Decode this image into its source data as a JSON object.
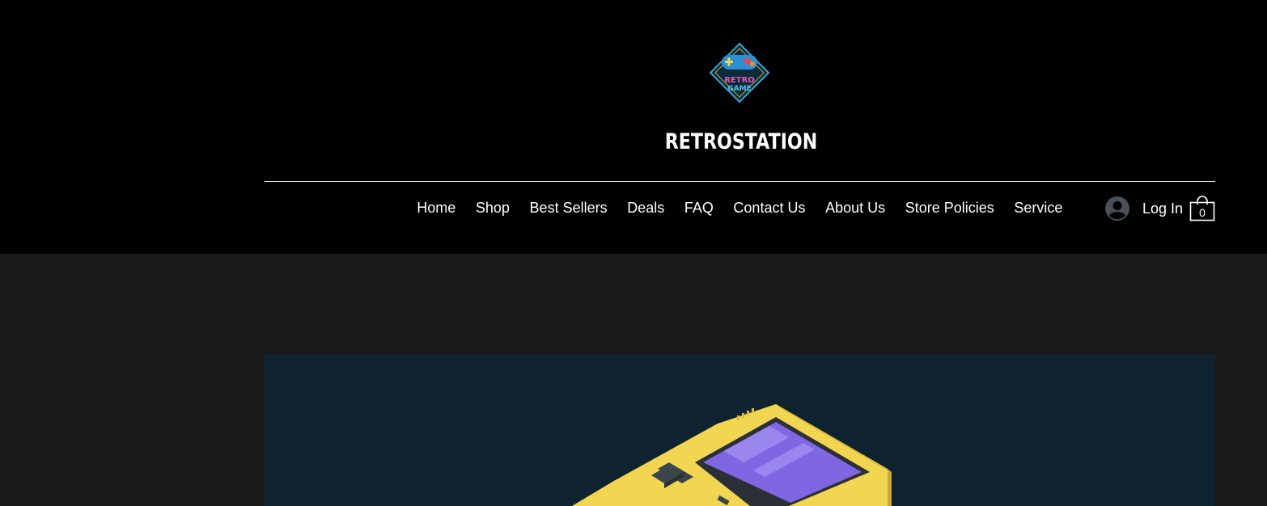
{
  "header": {
    "site_title": "RETROSTATION",
    "logo_icon": "retro-game-controller-logo-icon"
  },
  "nav": {
    "items": [
      {
        "label": "Home"
      },
      {
        "label": "Shop"
      },
      {
        "label": "Best Sellers"
      },
      {
        "label": "Deals"
      },
      {
        "label": "FAQ"
      },
      {
        "label": "Contact Us"
      },
      {
        "label": "About Us"
      },
      {
        "label": "Store Policies"
      },
      {
        "label": "Service"
      }
    ]
  },
  "account": {
    "login_label": "Log In",
    "avatar_icon": "user-avatar-icon"
  },
  "cart": {
    "count": "0",
    "icon": "shopping-bag-icon"
  },
  "hero": {
    "image": "handheld-game-console-illustration",
    "colors": {
      "background": "#0e222f",
      "console": "#f2d651",
      "screen": "#7f67e3"
    }
  },
  "colors": {
    "header_bg": "#000000",
    "page_bg": "#191919",
    "text": "#ffffff"
  }
}
